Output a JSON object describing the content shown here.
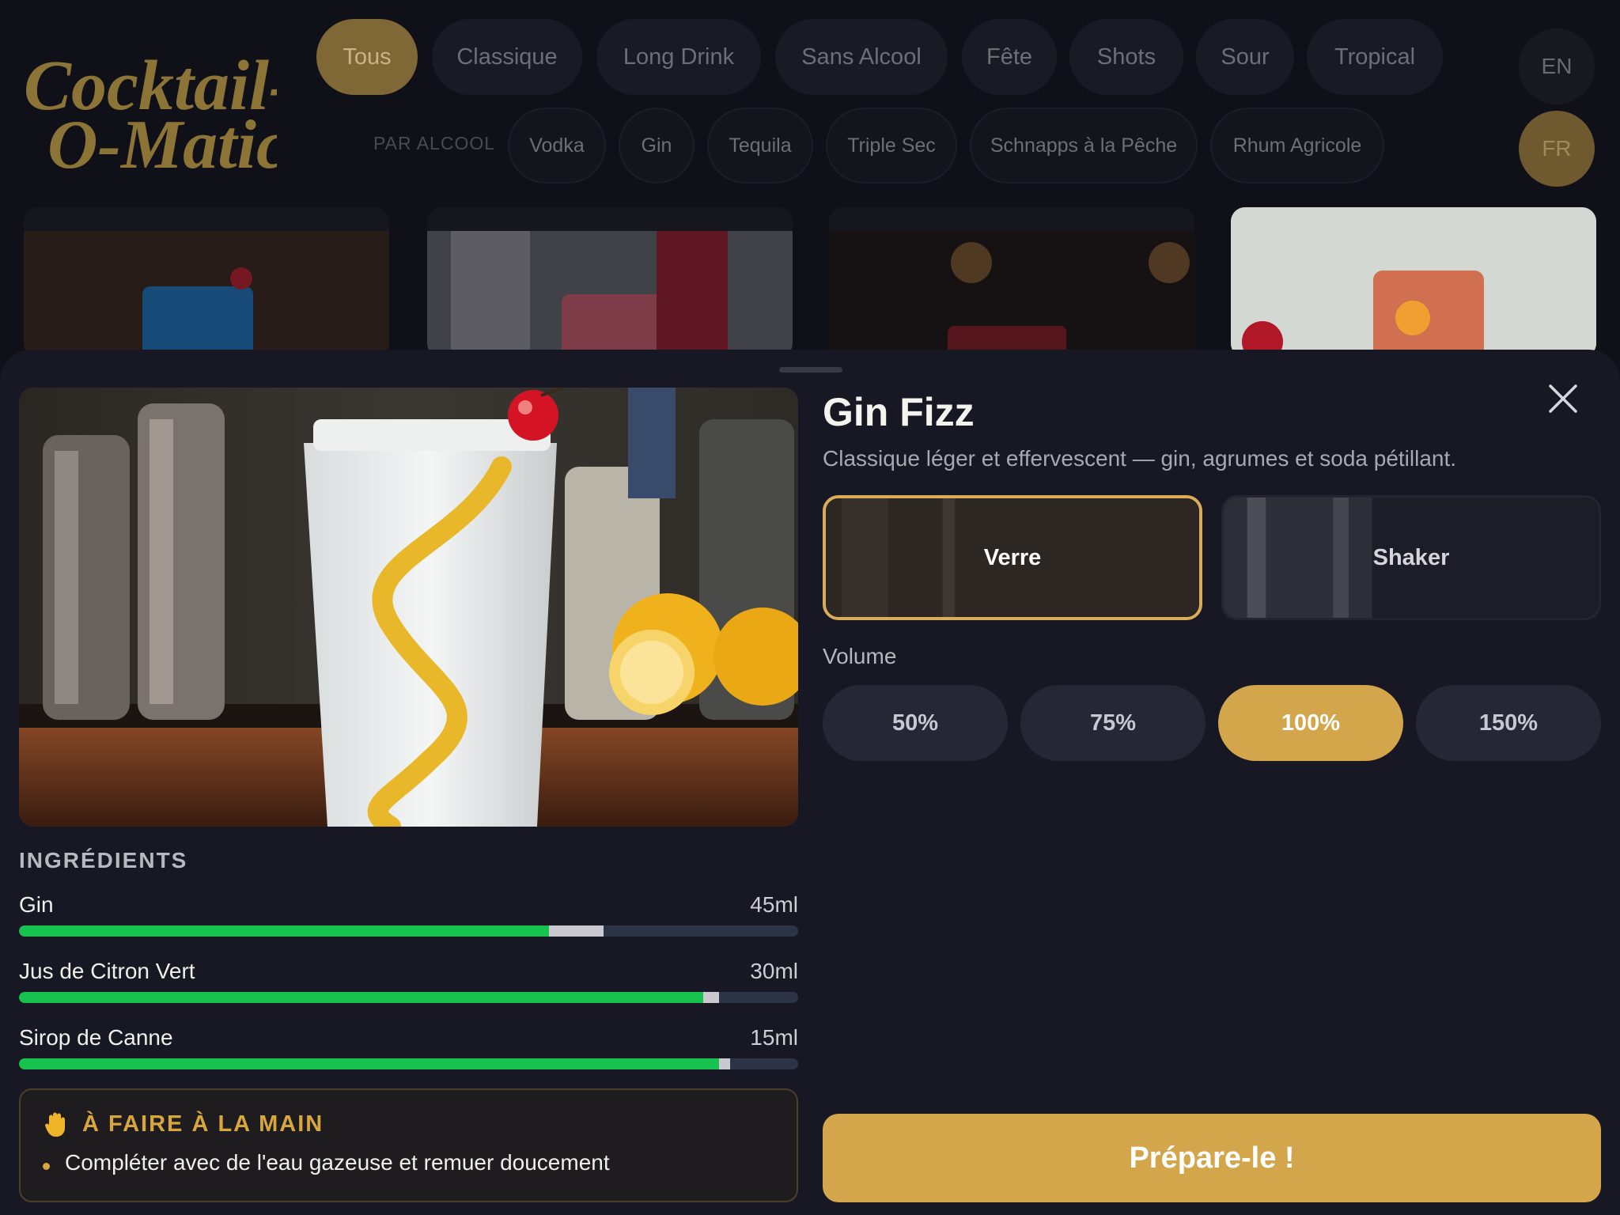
{
  "brand": {
    "line1": "Cocktail-",
    "line2": "O-Matic"
  },
  "categories": [
    {
      "label": "Tous",
      "active": true
    },
    {
      "label": "Classique",
      "active": false
    },
    {
      "label": "Long Drink",
      "active": false
    },
    {
      "label": "Sans Alcool",
      "active": false
    },
    {
      "label": "Fête",
      "active": false
    },
    {
      "label": "Shots",
      "active": false
    },
    {
      "label": "Sour",
      "active": false
    },
    {
      "label": "Tropical",
      "active": false
    }
  ],
  "spirits": {
    "label": "PAR ALCOOL",
    "items": [
      "Vodka",
      "Gin",
      "Tequila",
      "Triple Sec",
      "Schnapps à la Pêche",
      "Rhum Agricole"
    ]
  },
  "languages": [
    {
      "code": "EN",
      "active": false
    },
    {
      "code": "FR",
      "active": true
    }
  ],
  "detail": {
    "title": "Gin Fizz",
    "subtitle": "Classique léger et effervescent — gin, agrumes et soda pétillant.",
    "methods": [
      {
        "label": "Verre",
        "selected": true
      },
      {
        "label": "Shaker",
        "selected": false
      }
    ],
    "volume": {
      "label": "Volume",
      "options": [
        {
          "label": "50%",
          "selected": false
        },
        {
          "label": "75%",
          "selected": false
        },
        {
          "label": "100%",
          "selected": true
        },
        {
          "label": "150%",
          "selected": false
        }
      ]
    },
    "ingredients_title": "INGRÉDIENTS",
    "ingredients": [
      {
        "name": "Gin",
        "qty": "45ml",
        "level": 0.68,
        "marker_level": 0.75
      },
      {
        "name": "Jus de Citron Vert",
        "qty": "30ml",
        "level": 0.878,
        "marker_level": 0.898
      },
      {
        "name": "Sirop de Canne",
        "qty": "15ml",
        "level": 0.898,
        "marker_level": 0.913
      }
    ],
    "manual": {
      "title": "À FAIRE À LA MAIN",
      "icon": "hand-icon",
      "items": [
        "Compléter avec de l'eau gazeuse et remuer doucement"
      ]
    },
    "cta": "Prépare-le !"
  },
  "colors": {
    "accent": "#d4a64c",
    "progress": "#17c24e",
    "background": "#101018",
    "sheet": "#181824"
  }
}
